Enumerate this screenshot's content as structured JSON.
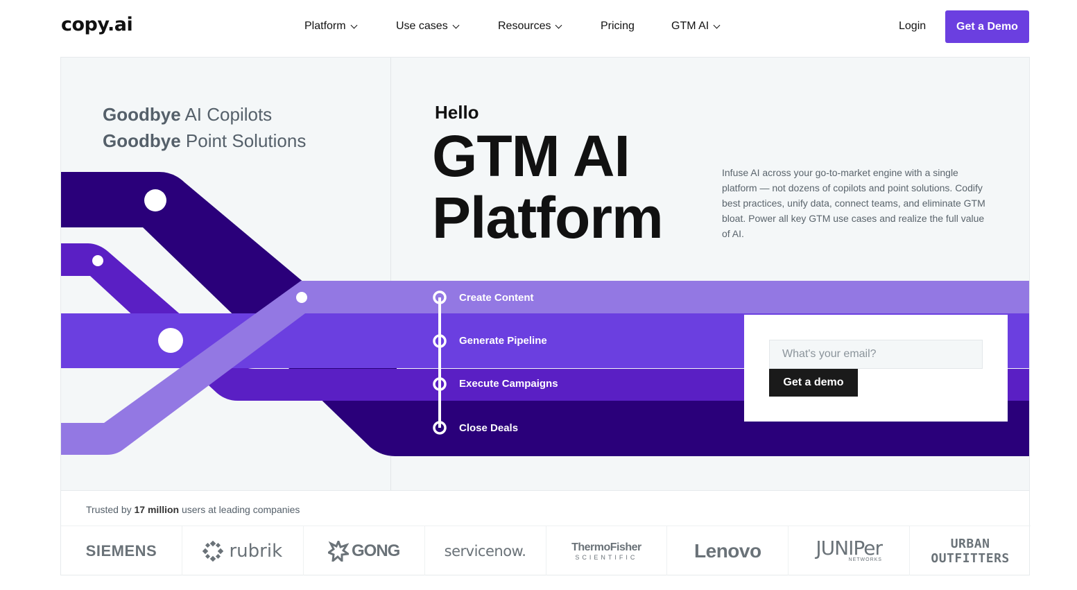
{
  "header": {
    "logo": "copy.ai",
    "nav": [
      {
        "label": "Platform",
        "has_dropdown": true
      },
      {
        "label": "Use cases",
        "has_dropdown": true
      },
      {
        "label": "Resources",
        "has_dropdown": true
      },
      {
        "label": "Pricing",
        "has_dropdown": false
      },
      {
        "label": "GTM AI",
        "has_dropdown": true
      }
    ],
    "login_label": "Login",
    "demo_label": "Get a Demo"
  },
  "hero": {
    "goodbye_lines": [
      {
        "bold": "Goodbye",
        "rest": " AI Copilots"
      },
      {
        "bold": "Goodbye",
        "rest": " Point Solutions"
      }
    ],
    "hello": "Hello",
    "headline_line1": "GTM AI",
    "headline_line2": "Platform",
    "description": "Infuse AI across your go-to-market engine with a single platform — not dozens of copilots and point solutions. Codify best practices, unify data, connect teams, and eliminate GTM bloat. Power all key GTM use cases and realize the full value of AI.",
    "steps": [
      "Create Content",
      "Generate Pipeline",
      "Execute Campaigns",
      "Close Deals"
    ],
    "email_placeholder": "What's your email?",
    "card_button_label": "Get a demo"
  },
  "trusted": {
    "prefix": "Trusted by ",
    "bold": "17 million",
    "suffix": " users at leading companies",
    "logos": {
      "siemens": "SIEMENS",
      "rubrik": "rubrik",
      "gong": "GONG",
      "servicenow": "servicenow.",
      "thermo_1": "ThermoFisher",
      "thermo_2": "SCIENTIFIC",
      "lenovo": "Lenovo",
      "juniper_1": "JUNIPer",
      "juniper_2": "NETWORKS",
      "urban_1": "URBAN",
      "urban_2": "OUTFITTERS"
    }
  },
  "colors": {
    "brand_purple": "#6b3fe0",
    "dark_purple": "#2a007a",
    "mid_purple": "#5a1fc4",
    "light_purple": "#9378e3",
    "hero_bg": "#f4f7f8"
  }
}
